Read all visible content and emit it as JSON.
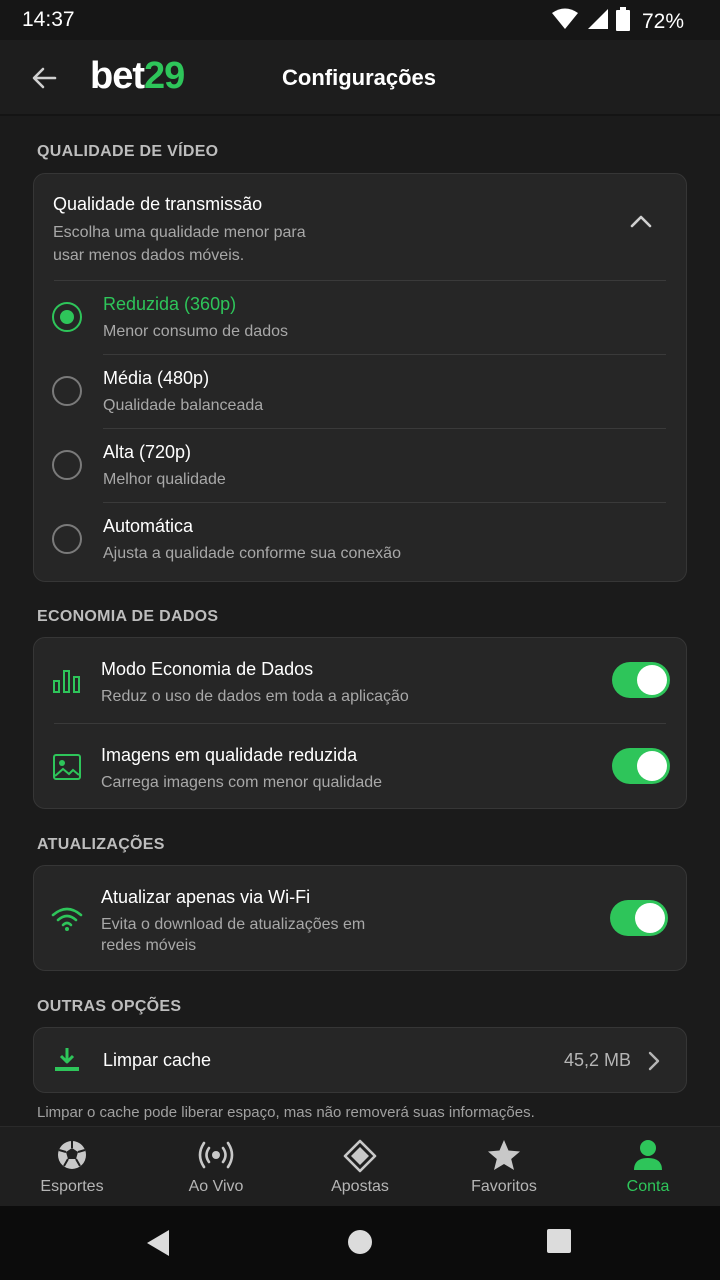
{
  "status": {
    "time": "14:37",
    "battery": "72%"
  },
  "header": {
    "logo_white": "bet",
    "logo_green": "29",
    "title": "Configurações"
  },
  "video": {
    "section_title": "QUALIDADE DE VÍDEO",
    "card_title": "Qualidade de transmissão",
    "card_desc_1": "Escolha uma qualidade menor para",
    "card_desc_2": "usar menos dados móveis.",
    "options": [
      {
        "label": "Reduzida (360p)",
        "desc": "Menor consumo de dados",
        "selected": true
      },
      {
        "label": "Média (480p)",
        "desc": "Qualidade balanceada",
        "selected": false
      },
      {
        "label": "Alta (720p)",
        "desc": "Melhor qualidade",
        "selected": false
      },
      {
        "label": "Automática",
        "desc": "Ajusta a qualidade conforme sua conexão",
        "selected": false
      }
    ]
  },
  "data_saving": {
    "section_title": "ECONOMIA DE DADOS",
    "items": [
      {
        "label": "Modo Economia de Dados",
        "desc": "Reduz o uso de dados em toda a aplicação",
        "on": true,
        "icon": "bar-chart-icon"
      },
      {
        "label": "Imagens em qualidade reduzida",
        "desc": "Carrega imagens com menor qualidade",
        "on": true,
        "icon": "image-icon"
      }
    ]
  },
  "updates": {
    "section_title": "ATUALIZAÇÕES",
    "label": "Atualizar apenas via Wi-Fi",
    "desc_1": "Evita o download de atualizações em",
    "desc_2": "redes móveis",
    "on": true
  },
  "other": {
    "section_title": "OUTRAS OPÇÕES",
    "clear_cache_label": "Limpar cache",
    "cache_size": "45,2 MB",
    "note": "Limpar o cache pode liberar espaço, mas não removerá suas informações."
  },
  "bottom_nav": {
    "items": [
      {
        "label": "Esportes",
        "icon": "soccer-ball-icon"
      },
      {
        "label": "Ao Vivo",
        "icon": "live-broadcast-icon"
      },
      {
        "label": "Apostas",
        "icon": "ticket-icon"
      },
      {
        "label": "Favoritos",
        "icon": "star-icon"
      },
      {
        "label": "Conta",
        "icon": "user-icon",
        "active": true
      }
    ]
  },
  "colors": {
    "accent": "#2ec55a",
    "background": "#1b1b1b",
    "card": "#262626"
  }
}
